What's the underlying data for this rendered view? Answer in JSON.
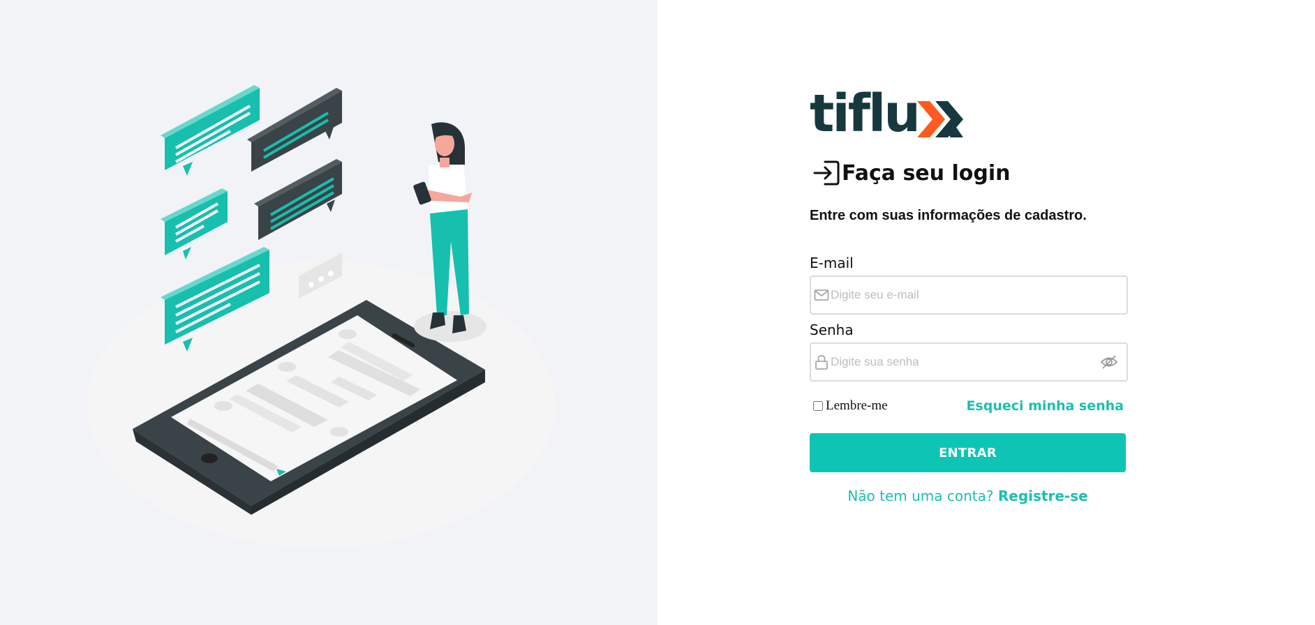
{
  "brand": {
    "name_main": "tiflu",
    "name_mark": "x",
    "colors": {
      "primary": "#0ec4b5",
      "dark": "#17383f",
      "accent": "#ff5a1f"
    }
  },
  "illustration": {
    "subject": "person-with-phone-and-chat-bubbles"
  },
  "login": {
    "title": "Faça seu login",
    "subtitle": "Entre com suas informações de cadastro.",
    "email": {
      "label": "E-mail",
      "placeholder": "Digite seu e-mail",
      "value": ""
    },
    "password": {
      "label": "Senha",
      "placeholder": "Digite sua senha",
      "value": ""
    },
    "remember_label": "Lembre-me",
    "forgot_label": "Esqueci minha senha",
    "submit_label": "ENTRAR",
    "register_prompt": "Não tem uma conta?",
    "register_link": "Registre-se"
  }
}
